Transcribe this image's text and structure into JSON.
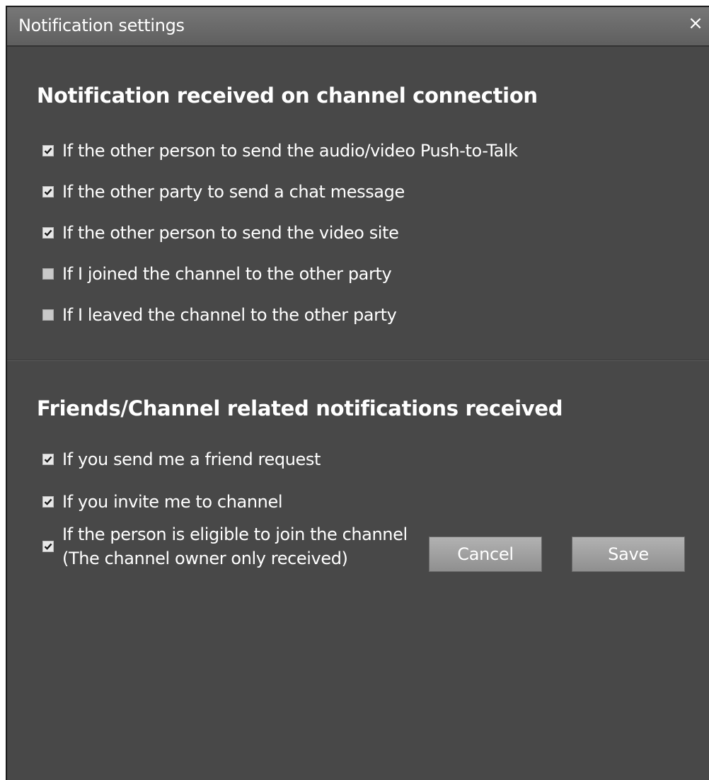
{
  "window": {
    "title": "Notification settings",
    "close_glyph": "×"
  },
  "section1": {
    "title": "Notification received on channel connection",
    "options": [
      {
        "label": "If the other person to send the audio/video Push-to-Talk",
        "checked": true
      },
      {
        "label": "If the other party to send a chat message",
        "checked": true
      },
      {
        "label": "If the other person to send the video site",
        "checked": true
      },
      {
        "label": "If I joined the channel to the other party",
        "checked": false
      },
      {
        "label": "If I leaved the channel to the other party",
        "checked": false
      }
    ]
  },
  "section2": {
    "title": "Friends/Channel related notifications received",
    "options": [
      {
        "label": "If you send me a friend request",
        "checked": true
      },
      {
        "label": "If you invite me to channel",
        "checked": true
      },
      {
        "label": "If the person is eligible to join the channel",
        "label2": "(The channel owner only received)",
        "checked": true
      }
    ]
  },
  "buttons": {
    "cancel": "Cancel",
    "save": "Save"
  },
  "colors": {
    "background": "#484848",
    "titlebar": "#6a6a6a",
    "text": "#ffffff",
    "button": "#a0a0a0"
  }
}
